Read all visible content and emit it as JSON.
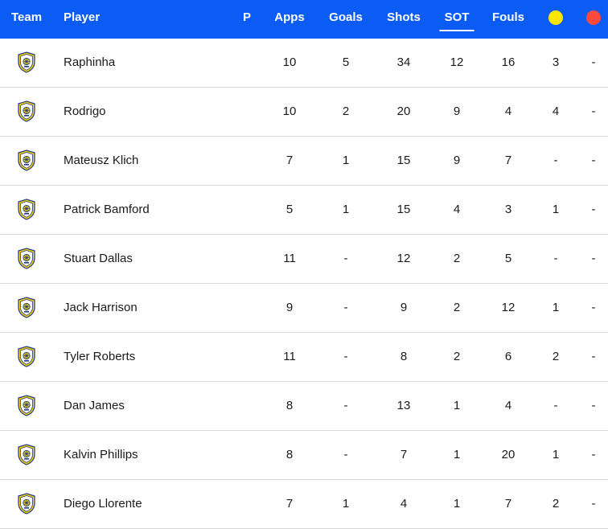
{
  "header": {
    "team": "Team",
    "player": "Player",
    "p": "P",
    "apps": "Apps",
    "goals": "Goals",
    "shots": "Shots",
    "sot": "SOT",
    "fouls": "Fouls",
    "yellow_icon": "yellow-card-icon",
    "red_icon": "red-card-icon",
    "colors": {
      "bar": "#0b5cf5",
      "yellow": "#ffe600",
      "red": "#ff4a3d"
    }
  },
  "team_icon": "leeds-united-crest-icon",
  "rows": [
    {
      "player": "Raphinha",
      "apps": "10",
      "goals": "5",
      "shots": "34",
      "sot": "12",
      "fouls": "16",
      "yellow": "3",
      "red": "-"
    },
    {
      "player": "Rodrigo",
      "apps": "10",
      "goals": "2",
      "shots": "20",
      "sot": "9",
      "fouls": "4",
      "yellow": "4",
      "red": "-"
    },
    {
      "player": "Mateusz Klich",
      "apps": "7",
      "goals": "1",
      "shots": "15",
      "sot": "9",
      "fouls": "7",
      "yellow": "-",
      "red": "-"
    },
    {
      "player": "Patrick Bamford",
      "apps": "5",
      "goals": "1",
      "shots": "15",
      "sot": "4",
      "fouls": "3",
      "yellow": "1",
      "red": "-"
    },
    {
      "player": "Stuart Dallas",
      "apps": "11",
      "goals": "-",
      "shots": "12",
      "sot": "2",
      "fouls": "5",
      "yellow": "-",
      "red": "-"
    },
    {
      "player": "Jack Harrison",
      "apps": "9",
      "goals": "-",
      "shots": "9",
      "sot": "2",
      "fouls": "12",
      "yellow": "1",
      "red": "-"
    },
    {
      "player": "Tyler Roberts",
      "apps": "11",
      "goals": "-",
      "shots": "8",
      "sot": "2",
      "fouls": "6",
      "yellow": "2",
      "red": "-"
    },
    {
      "player": "Dan James",
      "apps": "8",
      "goals": "-",
      "shots": "13",
      "sot": "1",
      "fouls": "4",
      "yellow": "-",
      "red": "-"
    },
    {
      "player": "Kalvin Phillips",
      "apps": "8",
      "goals": "-",
      "shots": "7",
      "sot": "1",
      "fouls": "20",
      "yellow": "1",
      "red": "-"
    },
    {
      "player": "Diego Llorente",
      "apps": "7",
      "goals": "1",
      "shots": "4",
      "sot": "1",
      "fouls": "7",
      "yellow": "2",
      "red": "-"
    }
  ]
}
